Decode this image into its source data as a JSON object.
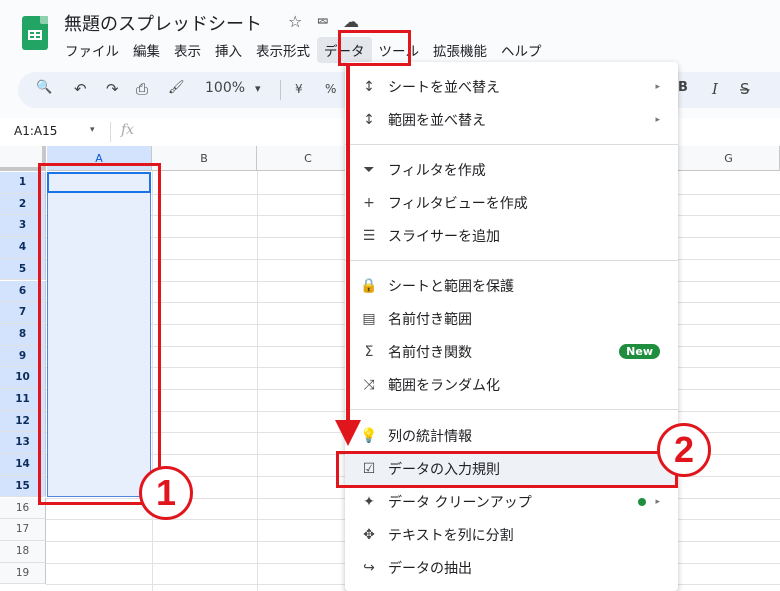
{
  "app": {
    "title": "無題のスプレッドシート",
    "title_icons": [
      "star-icon",
      "move-folder-icon",
      "cloud-status-icon"
    ],
    "star_glyph": "☆",
    "folder_glyph": "⮹",
    "cloud_glyph": "☁"
  },
  "menubar": [
    "ファイル",
    "編集",
    "表示",
    "挿入",
    "表示形式",
    "データ",
    "ツール",
    "拡張機能",
    "ヘルプ"
  ],
  "toolbar": {
    "search": "🔍",
    "undo": "↶",
    "redo": "↷",
    "print": "⎙",
    "paint_format": "🖌",
    "zoom": "100%",
    "zoom_caret": "▾",
    "currency": "¥",
    "percent": "%",
    "bold": "B",
    "italic": "I",
    "strike": "S̶"
  },
  "formula_bar": {
    "name_box": "A1:A15",
    "caret": "▾",
    "fx": "fx",
    "value": ""
  },
  "sheet": {
    "columns": [
      "A",
      "B",
      "C",
      "G"
    ],
    "rows": [
      "1",
      "2",
      "3",
      "4",
      "5",
      "6",
      "7",
      "8",
      "9",
      "10",
      "11",
      "12",
      "13",
      "14",
      "15",
      "16",
      "17",
      "18",
      "19"
    ],
    "selected_range": "A1:A15"
  },
  "data_menu": {
    "items": [
      {
        "icon": "↕",
        "label": "シートを並べ替え",
        "submenu": "▸"
      },
      {
        "icon": "↕",
        "label": "範囲を並べ替え",
        "submenu": "▸"
      },
      {
        "icon": "⏷",
        "label": "フィルタを作成"
      },
      {
        "icon": "+",
        "label": "フィルタビューを作成"
      },
      {
        "icon": "☰",
        "label": "スライサーを追加"
      },
      {
        "icon": "🔒",
        "label": "シートと範囲を保護"
      },
      {
        "icon": "▤",
        "label": "名前付き範囲"
      },
      {
        "icon": "Σ",
        "label": "名前付き関数",
        "badge": "New"
      },
      {
        "icon": "⤨",
        "label": "範囲をランダム化"
      },
      {
        "icon": "💡",
        "label": "列の統計情報"
      },
      {
        "icon": "☑",
        "label": "データの入力規則"
      },
      {
        "icon": "✦",
        "label": "データ クリーンアップ",
        "submenu": "▸"
      },
      {
        "icon": "✥",
        "label": "テキストを列に分割"
      },
      {
        "icon": "↪",
        "label": "データの抽出"
      }
    ],
    "highlighted": "データの入力規則"
  },
  "annotations": {
    "step1": "1",
    "step2": "2",
    "color": "#e0161c"
  }
}
